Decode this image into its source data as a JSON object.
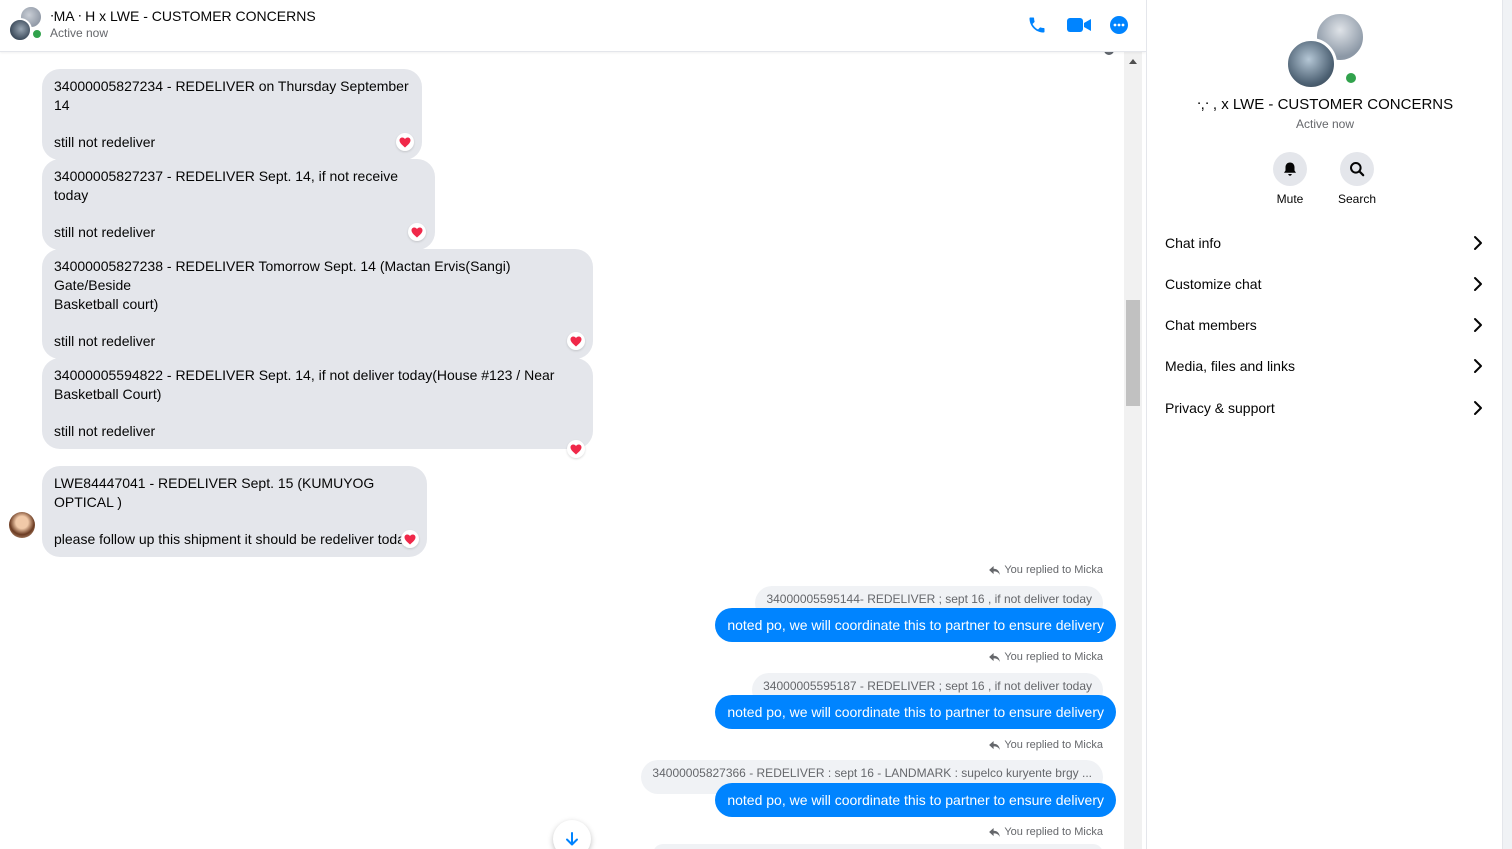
{
  "header": {
    "title": "ᐧMA ᐧ H x LWE - CUSTOMER CONCERNS",
    "status": "Active now"
  },
  "incoming": [
    {
      "line1": "34000005827234 - REDELIVER on Thursday September 14",
      "line2": "",
      "line3": "still not redeliver"
    },
    {
      "line1": "34000005827237 - REDELIVER Sept. 14, if not receive today",
      "line2": "",
      "line3": "still not redeliver"
    },
    {
      "line1": "34000005827238 - REDELIVER Tomorrow Sept. 14 (Mactan Ervis(Sangi) Gate/Beside",
      "line2": "Basketball court)",
      "line3": "still not redeliver"
    },
    {
      "line1": "34000005594822 - REDELIVER Sept. 14, if not deliver today(House #123 / Near",
      "line2": "Basketball Court)",
      "line3": "still not redeliver"
    },
    {
      "line1": "LWE84447041 - REDELIVER Sept. 15 (KUMUYOG OPTICAL )",
      "line2": "",
      "line3": "please follow up this shipment it should be redeliver today"
    }
  ],
  "replies": [
    {
      "replied": "You replied to Micka",
      "quote": "34000005595144- REDELIVER ; sept 16 , if not deliver today",
      "text": "noted po, we will coordinate this to partner to ensure delivery"
    },
    {
      "replied": "You replied to Micka",
      "quote": "34000005595187 - REDELIVER ; sept 16 , if not deliver today",
      "text": "noted po, we will coordinate this to partner to ensure delivery"
    },
    {
      "replied": "You replied to Micka",
      "quote": "34000005827366 - REDELIVER : sept 16 - LANDMARK : supelco kuryente brgy ...",
      "text": "noted po, we will coordinate this to partner to ensure delivery"
    },
    {
      "replied": "You replied to Micka",
      "quote": "",
      "text": ""
    }
  ],
  "panel": {
    "title": "ᐧ,ᐧ , x LWE - CUSTOMER CONCERNS",
    "status": "Active now",
    "actions": [
      {
        "label": "Mute",
        "icon": "bell-icon"
      },
      {
        "label": "Search",
        "icon": "search-icon"
      }
    ],
    "menu": [
      {
        "label": "Chat info"
      },
      {
        "label": "Customize chat"
      },
      {
        "label": "Chat members"
      },
      {
        "label": "Media, files and links"
      },
      {
        "label": "Privacy & support"
      }
    ]
  },
  "colors": {
    "accent": "#0084ff",
    "bubble_in": "#e4e6eb",
    "online": "#31a24c",
    "heart": "#f02849"
  }
}
